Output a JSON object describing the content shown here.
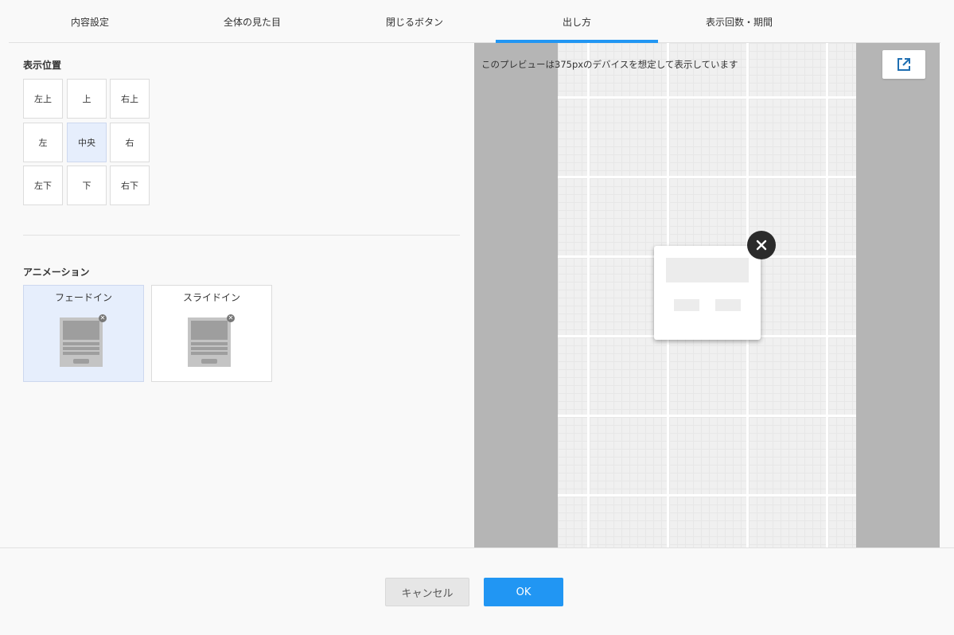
{
  "tabs": [
    {
      "label": "内容設定"
    },
    {
      "label": "全体の見た目"
    },
    {
      "label": "閉じるボタン"
    },
    {
      "label": "出し方"
    },
    {
      "label": "表示回数・期間"
    }
  ],
  "active_tab": "出し方",
  "position": {
    "title": "表示位置",
    "cells": [
      "左上",
      "上",
      "右上",
      "左",
      "中央",
      "右",
      "左下",
      "下",
      "右下"
    ],
    "selected": "中央"
  },
  "animation": {
    "title": "アニメーション",
    "options": [
      {
        "label": "フェードイン"
      },
      {
        "label": "スライドイン"
      }
    ],
    "selected": "フェードイン"
  },
  "preview": {
    "note": "このプレビューは375pxのデバイスを想定して表示しています",
    "open_icon": "external-link-icon",
    "close_icon": "close-icon"
  },
  "footer": {
    "cancel_label": "キャンセル",
    "ok_label": "OK"
  },
  "colors": {
    "accent": "#2196f3",
    "selected_bg": "#e6eefc",
    "preview_bg": "#b5b5b5"
  }
}
